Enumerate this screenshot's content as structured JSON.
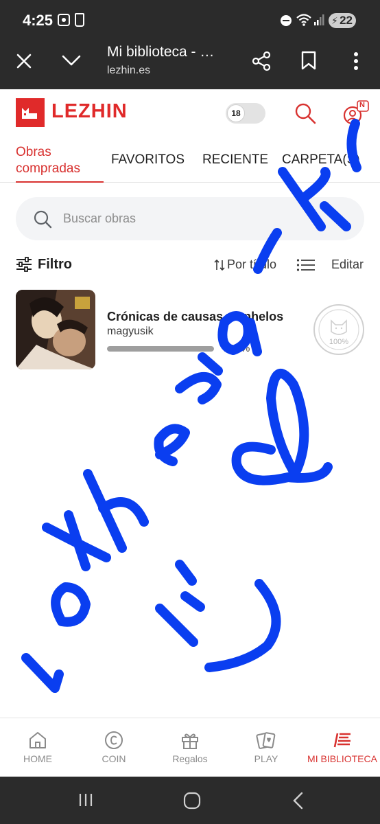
{
  "status_bar": {
    "time": "4:25",
    "battery": "22"
  },
  "browser": {
    "title": "Mi biblioteca - …",
    "url": "lezhin.es"
  },
  "app": {
    "logo_text": "LEZHIN",
    "adult_toggle_label": "18",
    "user_badge": "N",
    "accent_color": "#d8312f"
  },
  "tabs": [
    {
      "label": "Obras compradas",
      "active": true
    },
    {
      "label": "FAVORITOS",
      "active": false
    },
    {
      "label": "RECIENTE",
      "active": false
    },
    {
      "label": "CARPETA(S)",
      "active": false
    }
  ],
  "search": {
    "placeholder": "Buscar obras"
  },
  "toolbar": {
    "filter_label": "Filtro",
    "sort_label": "Por título",
    "edit_label": "Editar"
  },
  "books": [
    {
      "title": "Crónicas de causas y anhelos",
      "author": "magyusik",
      "progress_label": "100%",
      "progress": 1.0,
      "badge_label": "100%"
    }
  ],
  "bottom_nav": [
    {
      "label": "HOME",
      "icon": "home-icon",
      "active": false
    },
    {
      "label": "COIN",
      "icon": "coin-icon",
      "active": false
    },
    {
      "label": "Regalos",
      "icon": "gift-icon",
      "active": false
    },
    {
      "label": "PLAY",
      "icon": "play-cards-icon",
      "active": false
    },
    {
      "label": "MI BIBLIOTECA",
      "icon": "library-icon",
      "active": true
    }
  ],
  "scribble_color": "#0a3ef0"
}
